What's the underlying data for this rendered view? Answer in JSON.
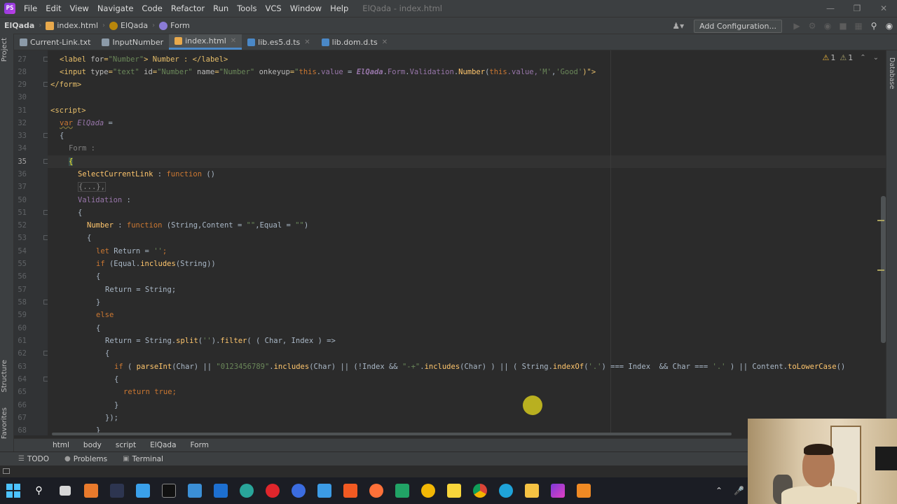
{
  "menu": [
    "File",
    "Edit",
    "View",
    "Navigate",
    "Code",
    "Refactor",
    "Run",
    "Tools",
    "VCS",
    "Window",
    "Help"
  ],
  "window_title": "ElQada - index.html",
  "navbar": {
    "project": "ElQada",
    "file": "index.html",
    "var": "ElQada",
    "prop": "Form",
    "add_config": "Add Configuration..."
  },
  "tabs": [
    {
      "label": "Current-Link.txt",
      "icon": "text-file-icon",
      "active": false
    },
    {
      "label": "InputNumber",
      "icon": "text-file-icon",
      "active": false
    },
    {
      "label": "index.html",
      "icon": "html-file-icon",
      "active": true
    },
    {
      "label": "lib.es5.d.ts",
      "icon": "ts-file-icon",
      "active": false
    },
    {
      "label": "lib.dom.d.ts",
      "icon": "ts-file-icon",
      "active": false
    }
  ],
  "side_labels": {
    "project": "Project",
    "structure": "Structure",
    "favorites": "Favorites",
    "database": "Database"
  },
  "inspections": {
    "warnings": "1",
    "weak_warnings": "1"
  },
  "line_numbers": [
    "27",
    "28",
    "29",
    "30",
    "31",
    "32",
    "33",
    "34",
    "35",
    "36",
    "37",
    "50",
    "51",
    "52",
    "53",
    "54",
    "55",
    "56",
    "57",
    "58",
    "59",
    "60",
    "61",
    "62",
    "63",
    "64",
    "65",
    "66",
    "67",
    "68"
  ],
  "current_line": "35",
  "code": {
    "l27": [
      "<label ",
      "for",
      "=",
      "\"Number\"",
      "> Number : </",
      "label",
      ">"
    ],
    "l28": [
      "<input ",
      "type",
      "=",
      "\"text\" ",
      "id",
      "=",
      "\"Number\" ",
      "name",
      "=",
      "\"Number\" ",
      "onkeyup",
      "=",
      "\"",
      "this",
      ".",
      "value",
      " = ",
      "ElQada",
      ".",
      "Form",
      ".",
      "Validation",
      ".",
      "Number",
      "(",
      "this",
      ".value,",
      "'M'",
      ",",
      "'Good'",
      ")\">"
    ],
    "l29": "</form>",
    "l31": "<script>",
    "l32_kw": "var",
    "l32_name": "ElQada",
    "l32_rest": " =",
    "l33": "{",
    "l34_name": "Form",
    "l34_rest": " :",
    "l35": "{",
    "l36_name": "SelectCurrentLink",
    "l36_mid": " : ",
    "l36_kw": "function",
    "l36_rest": " ()",
    "l37": "{...},",
    "l50_name": "Validation",
    "l50_rest": " :",
    "l51": "{",
    "l52_name": "Number",
    "l52_mid": " : ",
    "l52_kw": "function",
    "l52_rest": " (String,Content = ",
    "l52_s1": "\"\"",
    "l52_rest2": ",Equal = ",
    "l52_s2": "\"\"",
    "l52_end": ")",
    "l53": "{",
    "l54_kw": "let",
    "l54_rest": " Return = ",
    "l54_str": "''",
    "l54_end": ";",
    "l55_kw": "if",
    "l55_a": " (Equal.",
    "l55_fn": "includes",
    "l55_b": "(String))",
    "l56": "{",
    "l57": "Return = String;",
    "l58": "}",
    "l59_kw": "else",
    "l60": "{",
    "l61_a": "Return = String.",
    "l61_fn1": "split",
    "l61_b": "(",
    "l61_str": "''",
    "l61_c": ").",
    "l61_fn2": "filter",
    "l61_d": "( ( Char, Index ) =>",
    "l62": "{",
    "l63_kw": "if",
    "l63_a": " ( ",
    "l63_fn1": "parseInt",
    "l63_b": "(Char) || ",
    "l63_s1": "\"0123456789\"",
    "l63_c": ".",
    "l63_fn2": "includes",
    "l63_d": "(Char) || (!Index && ",
    "l63_s2": "\"-+\"",
    "l63_e": ".",
    "l63_fn3": "includes",
    "l63_f": "(Char) ) || ( String.",
    "l63_fn4": "indexOf",
    "l63_g": "(",
    "l63_s3": "'.'",
    "l63_h": ") === Index  && Char === ",
    "l63_s4": "'.'",
    "l63_i": " ) || Content.",
    "l63_fn5": "toLowerCase",
    "l63_j": "()",
    "l64": "{",
    "l65_kw": "return",
    "l65_kw2": "true",
    "l65_end": ";",
    "l66": "}",
    "l67": "});",
    "l68": "}"
  },
  "breadcrumbs": [
    "html",
    "body",
    "script",
    "ElQada",
    "Form"
  ],
  "tool_windows": [
    {
      "label": "TODO",
      "icon": "list-icon"
    },
    {
      "label": "Problems",
      "icon": "info-icon"
    },
    {
      "label": "Terminal",
      "icon": "terminal-icon"
    }
  ],
  "taskbar_apps": [
    "start",
    "search",
    "task-view",
    "app-orange",
    "app-dark",
    "store",
    "terminal",
    "app-blue",
    "mail",
    "edge-dev",
    "opera",
    "app-circle",
    "notepad",
    "brave",
    "firefox",
    "excel",
    "chrome-canary",
    "sticky-notes",
    "chrome",
    "edge",
    "explorer",
    "phpstorm",
    "app-orange-2"
  ],
  "colors": {
    "accent": "#4a88c7",
    "editor_bg": "#2b2b2b",
    "keyword": "#cc7832",
    "string": "#6a8759",
    "function": "#ffc66d",
    "field": "#9876aa"
  }
}
